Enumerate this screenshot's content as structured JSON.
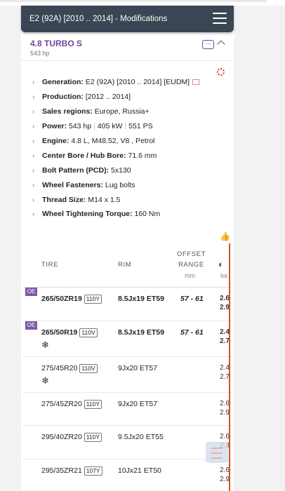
{
  "header": {
    "title": "E2 (92A) [2010 .. 2014] - Modifications"
  },
  "modification": {
    "name": "4.8 TURBO S",
    "power": "543 hp",
    "more_label": "···"
  },
  "specs": [
    {
      "label": "Generation:",
      "value": "E2 (92A) [2010 .. 2014] [EUDM]"
    },
    {
      "label": "Production:",
      "value": "[2012 .. 2014]"
    },
    {
      "label": "Sales regions:",
      "value": "Europe, Russia+"
    },
    {
      "label": "Power:",
      "value": "543 hp",
      "value2": "405 kW",
      "value3": "551 PS"
    },
    {
      "label": "Engine:",
      "value": "4.8 L, M48.52, V8 , Petrol"
    },
    {
      "label": "Center Bore / Hub Bore:",
      "value": "71.6 mm"
    },
    {
      "label": "Bolt Pattern (PCD):",
      "value": "5x130"
    },
    {
      "label": "Wheel Fasteners:",
      "value": "Lug bolts"
    },
    {
      "label": "Thread Size:",
      "value": "M14 x 1.5"
    },
    {
      "label": "Wheel Tightening Torque:",
      "value": "160 Nm"
    }
  ],
  "table": {
    "col_tire": "TIRE",
    "col_rim": "RIM",
    "col_offset_1": "OFFSET",
    "col_offset_2": "RANGE",
    "col_offset_unit": "mm",
    "col_pressure_unit": "ba",
    "rows": [
      {
        "oe": "OE",
        "tire": "265/50ZR19",
        "load": "110Y",
        "rim": "8.5Jx19 ET59",
        "offset": "57 - 61",
        "p1": "2.6",
        "p2": "2.9",
        "bold": true,
        "snow": false
      },
      {
        "oe": "OE",
        "tire": "265/50R19",
        "load": "110V",
        "rim": "8.5Jx19 ET59",
        "offset": "57 - 61",
        "p1": "2.4",
        "p2": "2.7",
        "bold": true,
        "snow": true
      },
      {
        "oe": "",
        "tire": "275/45R20",
        "load": "110V",
        "rim": "9Jx20 ET57",
        "offset": "",
        "p1": "2.4",
        "p2": "2.7",
        "bold": false,
        "snow": true
      },
      {
        "oe": "",
        "tire": "275/45ZR20",
        "load": "110Y",
        "rim": "9Jx20 ET57",
        "offset": "",
        "p1": "2.6",
        "p2": "2.9",
        "bold": false,
        "snow": false
      },
      {
        "oe": "",
        "tire": "295/40ZR20",
        "load": "110Y",
        "rim": "9.5Jx20 ET55",
        "offset": "",
        "p1": "2.6",
        "p2": "2.9",
        "bold": false,
        "snow": false
      },
      {
        "oe": "",
        "tire": "295/35ZR21",
        "load": "107Y",
        "rim": "10Jx21 ET50",
        "offset": "",
        "p1": "2.6",
        "p2": "2.9",
        "bold": false,
        "snow": false
      }
    ]
  },
  "snow_glyph": "❄",
  "accent_color": "#6a4a9a"
}
